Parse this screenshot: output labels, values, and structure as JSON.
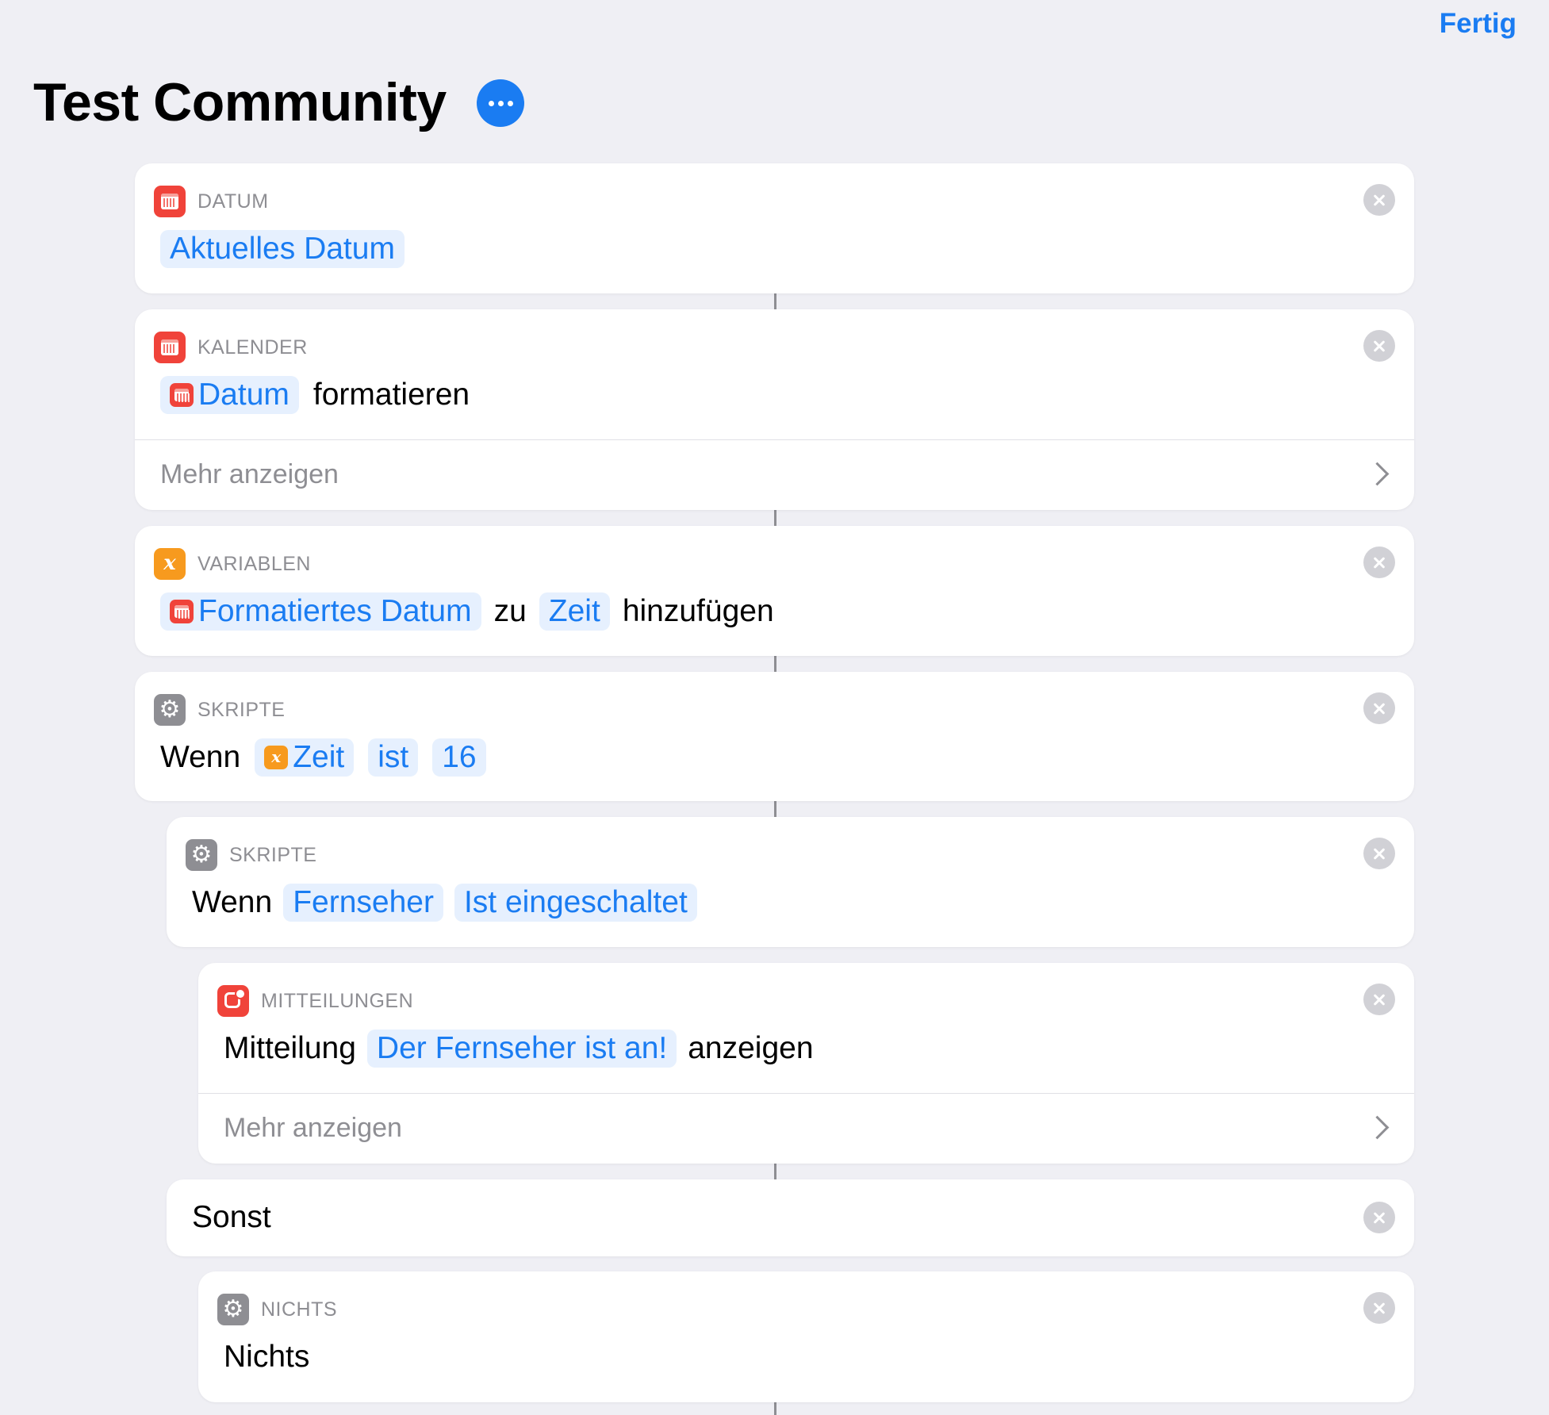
{
  "header": {
    "done_label": "Fertig",
    "title": "Test Community"
  },
  "actions": [
    {
      "category": "DATUM",
      "icon": "calendar-icon",
      "parts": [
        "Aktuelles Datum"
      ]
    },
    {
      "category": "KALENDER",
      "icon": "calendar-icon",
      "parts": [
        "Datum",
        "formatieren"
      ],
      "more_label": "Mehr anzeigen"
    },
    {
      "category": "VARIABLEN",
      "icon": "variable-icon",
      "parts": [
        "Formatiertes Datum",
        "zu",
        "Zeit",
        "hinzufügen"
      ]
    },
    {
      "category": "SKRIPTE",
      "icon": "gear-icon",
      "parts": [
        "Wenn",
        "Zeit",
        "ist",
        "16"
      ]
    },
    {
      "category": "SKRIPTE",
      "icon": "gear-icon",
      "parts": [
        "Wenn",
        "Fernseher",
        "Ist eingeschaltet"
      ]
    },
    {
      "category": "MITTEILUNGEN",
      "icon": "notification-icon",
      "parts": [
        "Mitteilung",
        "Der Fernseher ist an!",
        "anzeigen"
      ],
      "more_label": "Mehr anzeigen"
    },
    {
      "label": "Sonst"
    },
    {
      "category": "NICHTS",
      "icon": "gear-icon",
      "parts": [
        "Nichts"
      ]
    }
  ],
  "colors": {
    "accent": "#1a7cf2",
    "red_icon": "#f0433a",
    "orange_icon": "#f79a1e",
    "gray_icon": "#8e8e93",
    "background": "#efeff4"
  }
}
